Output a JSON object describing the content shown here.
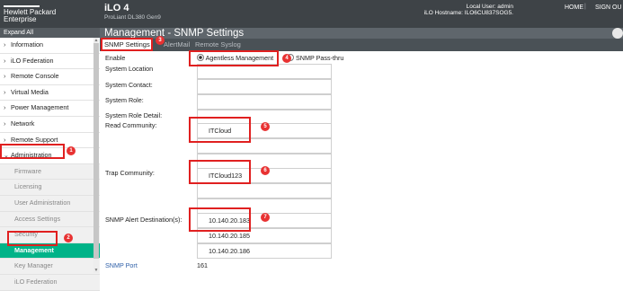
{
  "header": {
    "logo_line1": "Hewlett Packard",
    "logo_line2": "Enterprise",
    "title": "iLO 4",
    "model": "ProLiant DL380 Gen9",
    "local_user": "Local User: admin",
    "hostname": "iLO Hostname: ILO6CU837SOG5.",
    "home": "HOME",
    "signout": "SIGN OU"
  },
  "sidebar": {
    "expand_all": "Expand All",
    "items": [
      {
        "label": "Information",
        "expanded": false
      },
      {
        "label": "iLO Federation",
        "expanded": false
      },
      {
        "label": "Remote Console",
        "expanded": false
      },
      {
        "label": "Virtual Media",
        "expanded": false
      },
      {
        "label": "Power Management",
        "expanded": false
      },
      {
        "label": "Network",
        "expanded": false
      },
      {
        "label": "Remote Support",
        "expanded": false
      },
      {
        "label": "Administration",
        "expanded": true
      }
    ],
    "sub_items": [
      "Firmware",
      "Licensing",
      "User Administration",
      "Access Settings",
      "Security",
      "Management",
      "Key Manager",
      "iLO Federation"
    ],
    "active_sub": "Management"
  },
  "main": {
    "title": "Management - SNMP Settings",
    "tabs": [
      "SNMP Settings",
      "AlertMail",
      "Remote Syslog"
    ],
    "active_tab": "SNMP Settings",
    "labels": {
      "enable": "Enable",
      "location": "System Location",
      "contact": "System Contact:",
      "role": "System Role:",
      "role_detail": "System Role Detail:",
      "read_community": "Read Community:",
      "trap_community": "Trap Community:",
      "alert_destination": "SNMP Alert Destination(s):",
      "snmp_port": "SNMP Port"
    },
    "enable_options": [
      "Agentless Management",
      "SNMP Pass-thru"
    ],
    "enable_selected": "Agentless Management",
    "read_communities": [
      "ITCloud",
      "",
      ""
    ],
    "trap_communities": [
      "ITCloud123",
      "",
      ""
    ],
    "alert_destinations": [
      "10.140.20.183",
      "10.140.20.185",
      "10.140.20.186"
    ],
    "snmp_port_value": "161"
  },
  "annotations": [
    "1",
    "2",
    "3",
    "4",
    "5",
    "6",
    "7"
  ],
  "colors": {
    "accent": "#00b388",
    "annotation": "#e02020",
    "header": "#3e4347"
  }
}
